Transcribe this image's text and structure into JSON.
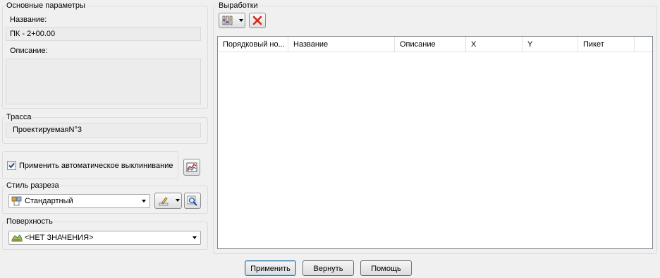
{
  "basic_params": {
    "legend": "Основные параметры",
    "name_label": "Название:",
    "name_value": "ПК - 2+00.00",
    "desc_label": "Описание:",
    "desc_value": ""
  },
  "trace": {
    "legend": "Трасса",
    "value": "ПроектируемаяN°3"
  },
  "auto_wedge": {
    "label": "Применить автоматическое выклинивание",
    "checked": true
  },
  "section_style": {
    "legend": "Стиль разреза",
    "selected": "Стандартный"
  },
  "surface": {
    "legend": "Поверхность",
    "selected": "<НЕТ ЗНАЧЕНИЯ>"
  },
  "workings": {
    "legend": "Выработки",
    "columns": [
      "Порядковый но...",
      "Название",
      "Описание",
      "X",
      "Y",
      "Пикет"
    ],
    "rows": []
  },
  "buttons": {
    "apply": "Применить",
    "revert": "Вернуть",
    "help": "Помощь"
  }
}
